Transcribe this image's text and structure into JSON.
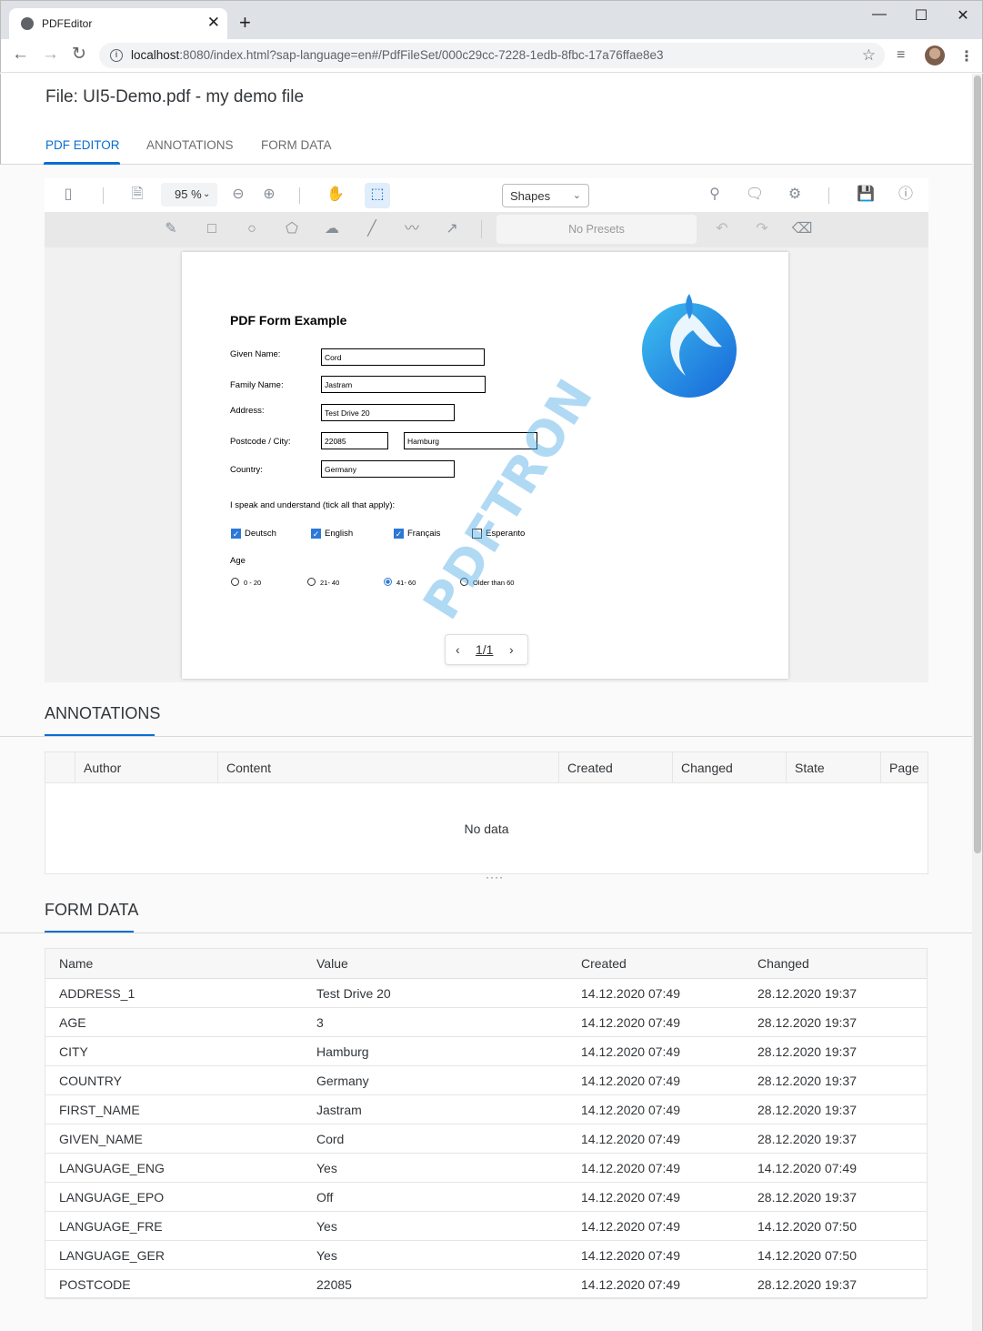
{
  "browser": {
    "tab_title": "PDFEditor",
    "url_host": "localhost",
    "url_rest": ":8080/index.html?sap-language=en#/PdfFileSet/000c29cc-7228-1edb-8fbc-17a76ffae8e3"
  },
  "app": {
    "title": "File: UI5-Demo.pdf - my demo file",
    "tabs": [
      {
        "label": "PDF EDITOR"
      },
      {
        "label": "ANNOTATIONS"
      },
      {
        "label": "FORM DATA"
      }
    ]
  },
  "viewer": {
    "zoom": "95 %",
    "shape_select": "Shapes",
    "presets": "No Presets",
    "page_indicator": "1/1"
  },
  "pdf": {
    "title": "PDF Form Example",
    "labels": {
      "given_name": "Given Name:",
      "family_name": "Family Name:",
      "address": "Address:",
      "postcode_city": "Postcode / City:",
      "country": "Country:",
      "speak": "I speak and understand (tick all that apply):",
      "age": "Age"
    },
    "fields": {
      "given_name": "Cord",
      "family_name": "Jastram",
      "address": "Test Drive 20",
      "postcode": "22085",
      "city": "Hamburg",
      "country": "Germany"
    },
    "languages": [
      {
        "label": "Deutsch",
        "checked": true
      },
      {
        "label": "English",
        "checked": true
      },
      {
        "label": "Français",
        "checked": true
      },
      {
        "label": "Esperanto",
        "checked": false
      }
    ],
    "ages": [
      {
        "label": "0 - 20",
        "selected": false
      },
      {
        "label": "21- 40",
        "selected": false
      },
      {
        "label": "41- 60",
        "selected": true
      },
      {
        "label": "Older than 60",
        "selected": false
      }
    ],
    "watermark": "PDFTRON"
  },
  "annotations": {
    "title": "ANNOTATIONS",
    "columns": [
      "Author",
      "Content",
      "Created",
      "Changed",
      "State",
      "Page"
    ],
    "empty_text": "No data"
  },
  "form_data": {
    "title": "FORM DATA",
    "columns": [
      "Name",
      "Value",
      "Created",
      "Changed"
    ],
    "rows": [
      [
        "ADDRESS_1",
        "Test Drive 20",
        "14.12.2020 07:49",
        "28.12.2020 19:37"
      ],
      [
        "AGE",
        "3",
        "14.12.2020 07:49",
        "28.12.2020 19:37"
      ],
      [
        "CITY",
        "Hamburg",
        "14.12.2020 07:49",
        "28.12.2020 19:37"
      ],
      [
        "COUNTRY",
        "Germany",
        "14.12.2020 07:49",
        "28.12.2020 19:37"
      ],
      [
        "FIRST_NAME",
        "Jastram",
        "14.12.2020 07:49",
        "28.12.2020 19:37"
      ],
      [
        "GIVEN_NAME",
        "Cord",
        "14.12.2020 07:49",
        "28.12.2020 19:37"
      ],
      [
        "LANGUAGE_ENG",
        "Yes",
        "14.12.2020 07:49",
        "14.12.2020 07:49"
      ],
      [
        "LANGUAGE_EPO",
        "Off",
        "14.12.2020 07:49",
        "28.12.2020 19:37"
      ],
      [
        "LANGUAGE_FRE",
        "Yes",
        "14.12.2020 07:49",
        "14.12.2020 07:50"
      ],
      [
        "LANGUAGE_GER",
        "Yes",
        "14.12.2020 07:49",
        "14.12.2020 07:50"
      ],
      [
        "POSTCODE",
        "22085",
        "14.12.2020 07:49",
        "28.12.2020 19:37"
      ]
    ]
  }
}
